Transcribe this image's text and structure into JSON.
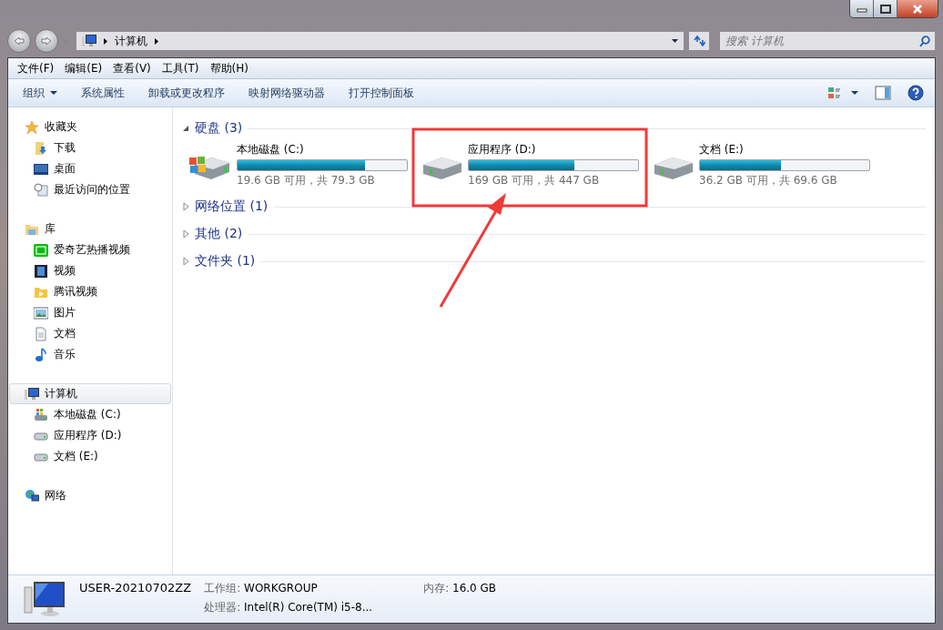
{
  "address": {
    "segments": [
      "计算机"
    ]
  },
  "search": {
    "placeholder": "搜索 计算机"
  },
  "menu": [
    "文件(F)",
    "编辑(E)",
    "查看(V)",
    "工具(T)",
    "帮助(H)"
  ],
  "toolbar": [
    {
      "label": "组织",
      "dropdown": true
    },
    {
      "label": "系统属性",
      "dropdown": false
    },
    {
      "label": "卸载或更改程序",
      "dropdown": false
    },
    {
      "label": "映射网络驱动器",
      "dropdown": false
    },
    {
      "label": "打开控制面板",
      "dropdown": false
    }
  ],
  "sidebar": {
    "groups": [
      {
        "label": "收藏夹",
        "kind": "star",
        "selected": false,
        "children": [
          {
            "label": "下载",
            "kind": "download",
            "selected": false
          },
          {
            "label": "桌面",
            "kind": "desktop",
            "selected": false
          },
          {
            "label": "最近访问的位置",
            "kind": "recent",
            "selected": false
          }
        ]
      },
      {
        "label": "库",
        "kind": "library",
        "selected": false,
        "children": [
          {
            "label": "爱奇艺热播视频",
            "kind": "iqiyi",
            "selected": false
          },
          {
            "label": "视频",
            "kind": "film",
            "selected": false
          },
          {
            "label": "腾讯视频",
            "kind": "tencent",
            "selected": false
          },
          {
            "label": "图片",
            "kind": "image",
            "selected": false
          },
          {
            "label": "文档",
            "kind": "doc",
            "selected": false
          },
          {
            "label": "音乐",
            "kind": "music",
            "selected": false
          }
        ]
      },
      {
        "label": "计算机",
        "kind": "computer",
        "selected": true,
        "children": [
          {
            "label": "本地磁盘 (C:)",
            "kind": "windrive",
            "selected": false
          },
          {
            "label": "应用程序 (D:)",
            "kind": "drive",
            "selected": false
          },
          {
            "label": "文档 (E:)",
            "kind": "drive",
            "selected": false
          }
        ]
      },
      {
        "label": "网络",
        "kind": "network",
        "selected": false
      }
    ]
  },
  "sections": [
    {
      "title": "硬盘 (3)",
      "expanded": true,
      "drives": [
        {
          "name": "本地磁盘 (C:)",
          "kind": "windrive",
          "level": 0.753,
          "space": "19.6 GB 可用，共 79.3 GB"
        },
        {
          "name": "应用程序 (D:)",
          "kind": "drive",
          "level": 0.622,
          "space": "169 GB 可用，共 447 GB"
        },
        {
          "name": "文档 (E:)",
          "kind": "drive",
          "level": 0.48,
          "space": "36.2 GB 可用，共 69.6 GB"
        }
      ]
    },
    {
      "title": "网络位置 (1)",
      "expanded": false
    },
    {
      "title": "其他 (2)",
      "expanded": false
    },
    {
      "title": "文件夹 (1)",
      "expanded": false
    }
  ],
  "details": {
    "name": "USER-20210702ZZ",
    "fields": [
      {
        "label": "工作组:",
        "value": "WORKGROUP"
      },
      {
        "label": "内存:",
        "value": "16.0 GB"
      },
      {
        "label": "处理器:",
        "value": "Intel(R) Core(TM) i5-8..."
      }
    ]
  }
}
